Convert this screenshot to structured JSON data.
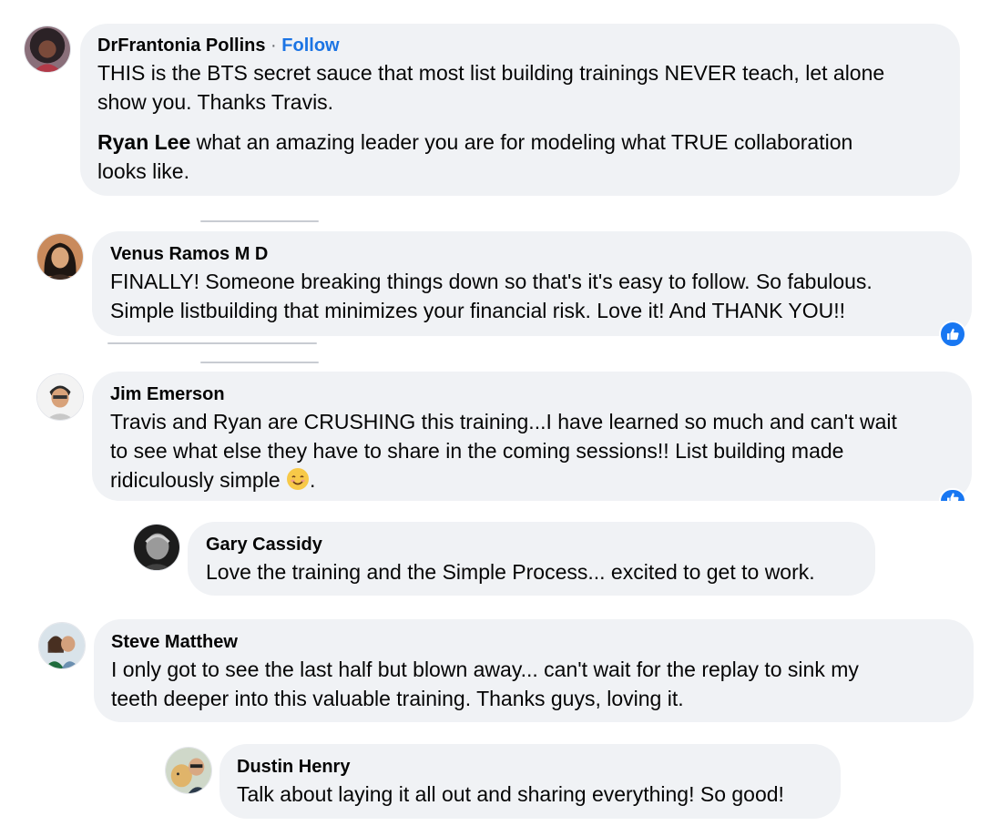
{
  "comments": [
    {
      "author": "DrFrantonia Pollins",
      "separator": "·",
      "follow_label": "Follow",
      "text_line1": "THIS is the BTS secret sauce that most list building trainings NEVER teach, let alone",
      "text_line2": "show you. Thanks Travis.",
      "mention": "Ryan Lee",
      "text2_line1": " what an amazing leader you are for modeling what TRUE collaboration",
      "text2_line2": "looks like."
    },
    {
      "author": "Venus Ramos M D",
      "text_line1": "FINALLY! Someone breaking things down so that's it's easy to follow. So fabulous.",
      "text_line2": "Simple listbuilding that minimizes your financial risk. Love it! And THANK YOU!!"
    },
    {
      "author": "Jim Emerson",
      "text_line1": "Travis and Ryan are CRUSHING this training...I have learned so much and can't wait",
      "text_line2": "to see what else they have to share in the coming sessions!! List building made",
      "text_line3": "ridiculously simple ",
      "text_tail": ".",
      "emoji": "smiling-face-emoji"
    },
    {
      "author": "Gary Cassidy",
      "text_line1": "Love the training and the Simple Process... excited to get to work."
    },
    {
      "author": "Steve Matthew",
      "text_line1": "I only got to see the last half but blown away... can't wait for the replay to sink my",
      "text_line2": "teeth deeper into this valuable training. Thanks guys, loving it."
    },
    {
      "author": "Dustin Henry",
      "text_line1": "Talk about laying it all out and sharing everything! So good!"
    }
  ],
  "colors": {
    "bubble": "#f0f2f5",
    "follow": "#1b74e4",
    "like_badge": "#1877f2"
  },
  "icons": [
    "thumbs-up-icon"
  ]
}
